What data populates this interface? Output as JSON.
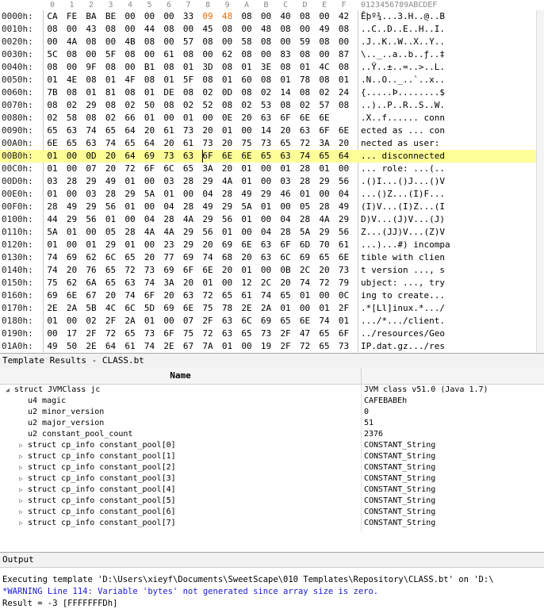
{
  "hex": {
    "ruler_cols": [
      "0",
      "1",
      "2",
      "3",
      "4",
      "5",
      "6",
      "7",
      "8",
      "9",
      "A",
      "B",
      "C",
      "D",
      "E",
      "F"
    ],
    "ruler_ascii": "0123456789ABCDEF",
    "rows": [
      {
        "addr": "0000h:",
        "bytes": [
          "CA",
          "FE",
          "BA",
          "BE",
          "00",
          "00",
          "00",
          "33",
          "09",
          "48",
          "08",
          "00",
          "40",
          "08",
          "00",
          "42"
        ],
        "ascii": "Êþº¾...3.H..@..B"
      },
      {
        "addr": "0010h:",
        "bytes": [
          "08",
          "00",
          "43",
          "08",
          "00",
          "44",
          "08",
          "00",
          "45",
          "08",
          "00",
          "48",
          "08",
          "00",
          "49",
          "08"
        ],
        "ascii": "..C..D..E..H..I."
      },
      {
        "addr": "0020h:",
        "bytes": [
          "00",
          "4A",
          "08",
          "00",
          "4B",
          "08",
          "00",
          "57",
          "08",
          "00",
          "58",
          "08",
          "00",
          "59",
          "08",
          "00"
        ],
        "ascii": ".J..K..W..X..Y.."
      },
      {
        "addr": "0030h:",
        "bytes": [
          "5C",
          "08",
          "00",
          "5F",
          "08",
          "00",
          "61",
          "08",
          "00",
          "62",
          "08",
          "00",
          "83",
          "08",
          "00",
          "87"
        ],
        "ascii": "\\.._..a..b..ƒ..‡"
      },
      {
        "addr": "0040h:",
        "bytes": [
          "08",
          "00",
          "9F",
          "08",
          "00",
          "B1",
          "08",
          "01",
          "3D",
          "08",
          "01",
          "3E",
          "08",
          "01",
          "4C",
          "08"
        ],
        "ascii": "..Ÿ..±..=..>..L."
      },
      {
        "addr": "0050h:",
        "bytes": [
          "01",
          "4E",
          "08",
          "01",
          "4F",
          "08",
          "01",
          "5F",
          "08",
          "01",
          "60",
          "08",
          "01",
          "78",
          "08",
          "01"
        ],
        "ascii": ".N..O.._..`..x.."
      },
      {
        "addr": "0060h:",
        "bytes": [
          "7B",
          "08",
          "01",
          "81",
          "08",
          "01",
          "DE",
          "08",
          "02",
          "0D",
          "08",
          "02",
          "14",
          "08",
          "02",
          "24"
        ],
        "ascii": "{.....Þ........$"
      },
      {
        "addr": "0070h:",
        "bytes": [
          "08",
          "02",
          "29",
          "08",
          "02",
          "50",
          "08",
          "02",
          "52",
          "08",
          "02",
          "53",
          "08",
          "02",
          "57",
          "08"
        ],
        "ascii": "..)..P..R..S..W."
      },
      {
        "addr": "0080h:",
        "bytes": [
          "02",
          "58",
          "08",
          "02",
          "66",
          "01",
          "00",
          "01",
          "00",
          "0E",
          "20",
          "63",
          "6F",
          "6E",
          "6E"
        ],
        "ascii": ".X..f...... conn"
      },
      {
        "addr": "0090h:",
        "bytes": [
          "65",
          "63",
          "74",
          "65",
          "64",
          "20",
          "61",
          "73",
          "20",
          "01",
          "00",
          "14",
          "20",
          "63",
          "6F",
          "6E"
        ],
        "ascii": "ected as ... con"
      },
      {
        "addr": "00A0h:",
        "bytes": [
          "6E",
          "65",
          "63",
          "74",
          "65",
          "64",
          "20",
          "61",
          "73",
          "20",
          "75",
          "73",
          "65",
          "72",
          "3A",
          "20"
        ],
        "ascii": "nected as user: "
      },
      {
        "addr": "00B0h:",
        "bytes": [
          "01",
          "00",
          "0D",
          "20",
          "64",
          "69",
          "73",
          "63",
          "6F",
          "6E",
          "6E",
          "65",
          "63",
          "74",
          "65",
          "64"
        ],
        "ascii": "... disconnected"
      },
      {
        "addr": "00C0h:",
        "bytes": [
          "01",
          "00",
          "07",
          "20",
          "72",
          "6F",
          "6C",
          "65",
          "3A",
          "20",
          "01",
          "00",
          "01",
          "28",
          "01",
          "00"
        ],
        "ascii": "... role: ...(.."
      },
      {
        "addr": "00D0h:",
        "bytes": [
          "03",
          "28",
          "29",
          "49",
          "01",
          "00",
          "03",
          "28",
          "29",
          "4A",
          "01",
          "00",
          "03",
          "28",
          "29",
          "56"
        ],
        "ascii": ".()I...()J...()V"
      },
      {
        "addr": "00E0h:",
        "bytes": [
          "01",
          "00",
          "03",
          "28",
          "29",
          "5A",
          "01",
          "00",
          "04",
          "28",
          "49",
          "29",
          "46",
          "01",
          "00",
          "04"
        ],
        "ascii": "...()Z...(I)F..."
      },
      {
        "addr": "00F0h:",
        "bytes": [
          "28",
          "49",
          "29",
          "56",
          "01",
          "00",
          "04",
          "28",
          "49",
          "29",
          "5A",
          "01",
          "00",
          "05",
          "28",
          "49"
        ],
        "ascii": "(I)V...(I)Z...(I"
      },
      {
        "addr": "0100h:",
        "bytes": [
          "44",
          "29",
          "56",
          "01",
          "00",
          "04",
          "28",
          "4A",
          "29",
          "56",
          "01",
          "00",
          "04",
          "28",
          "4A",
          "29"
        ],
        "ascii": "D)V...(J)V...(J)"
      },
      {
        "addr": "0110h:",
        "bytes": [
          "5A",
          "01",
          "00",
          "05",
          "28",
          "4A",
          "4A",
          "29",
          "56",
          "01",
          "00",
          "04",
          "28",
          "5A",
          "29",
          "56"
        ],
        "ascii": "Z...(JJ)V...(Z)V"
      },
      {
        "addr": "0120h:",
        "bytes": [
          "01",
          "00",
          "01",
          "29",
          "01",
          "00",
          "23",
          "29",
          "20",
          "69",
          "6E",
          "63",
          "6F",
          "6D",
          "70",
          "61"
        ],
        "ascii": "...)...#) incompa"
      },
      {
        "addr": "0130h:",
        "bytes": [
          "74",
          "69",
          "62",
          "6C",
          "65",
          "20",
          "77",
          "69",
          "74",
          "68",
          "20",
          "63",
          "6C",
          "69",
          "65",
          "6E"
        ],
        "ascii": "tible with clien"
      },
      {
        "addr": "0140h:",
        "bytes": [
          "74",
          "20",
          "76",
          "65",
          "72",
          "73",
          "69",
          "6F",
          "6E",
          "20",
          "01",
          "00",
          "0B",
          "2C",
          "20",
          "73"
        ],
        "ascii": "t version ..., s"
      },
      {
        "addr": "0150h:",
        "bytes": [
          "75",
          "62",
          "6A",
          "65",
          "63",
          "74",
          "3A",
          "20",
          "01",
          "00",
          "12",
          "2C",
          "20",
          "74",
          "72",
          "79"
        ],
        "ascii": "ubject: ..., try"
      },
      {
        "addr": "0160h:",
        "bytes": [
          "69",
          "6E",
          "67",
          "20",
          "74",
          "6F",
          "20",
          "63",
          "72",
          "65",
          "61",
          "74",
          "65",
          "01",
          "00",
          "0C"
        ],
        "ascii": "ing to create..."
      },
      {
        "addr": "0170h:",
        "bytes": [
          "2E",
          "2A",
          "5B",
          "4C",
          "6C",
          "5D",
          "69",
          "6E",
          "75",
          "78",
          "2E",
          "2A",
          "01",
          "00",
          "01",
          "2F"
        ],
        "ascii": ".*[Ll]inux.*.../"
      },
      {
        "addr": "0180h:",
        "bytes": [
          "01",
          "00",
          "02",
          "2F",
          "2A",
          "01",
          "00",
          "07",
          "2F",
          "63",
          "6C",
          "69",
          "65",
          "6E",
          "74",
          "01"
        ],
        "ascii": ".../*.../client."
      },
      {
        "addr": "0190h:",
        "bytes": [
          "00",
          "17",
          "2F",
          "72",
          "65",
          "73",
          "6F",
          "75",
          "72",
          "63",
          "65",
          "73",
          "2F",
          "47",
          "65",
          "6F"
        ],
        "ascii": "../resources/Geo"
      },
      {
        "addr": "01A0h:",
        "bytes": [
          "49",
          "50",
          "2E",
          "64",
          "61",
          "74",
          "2E",
          "67",
          "7A",
          "01",
          "00",
          "19",
          "2F",
          "72",
          "65",
          "73"
        ],
        "ascii": "IP.dat.gz.../res"
      }
    ]
  },
  "template": {
    "panel_title": "Template Results - CLASS.bt",
    "column_name": "Name",
    "rows": [
      {
        "name": "struct JVMClass jc",
        "value": "JVM class v51.0 (Java 1.7)",
        "level": 0,
        "toggle": "open"
      },
      {
        "name": "u4 magic",
        "value": "CAFEBABEh",
        "level": 1,
        "toggle": "none"
      },
      {
        "name": "u2 minor_version",
        "value": "0",
        "level": 1,
        "toggle": "none"
      },
      {
        "name": "u2 major_version",
        "value": "51",
        "level": 1,
        "toggle": "none"
      },
      {
        "name": "u2 constant_pool_count",
        "value": "2376",
        "level": 1,
        "toggle": "none"
      },
      {
        "name": "struct cp_info constant_pool[0]",
        "value": "CONSTANT_String",
        "level": 1,
        "toggle": "closed"
      },
      {
        "name": "struct cp_info constant_pool[1]",
        "value": "CONSTANT_String",
        "level": 1,
        "toggle": "closed"
      },
      {
        "name": "struct cp_info constant_pool[2]",
        "value": "CONSTANT_String",
        "level": 1,
        "toggle": "closed"
      },
      {
        "name": "struct cp_info constant_pool[3]",
        "value": "CONSTANT_String",
        "level": 1,
        "toggle": "closed"
      },
      {
        "name": "struct cp_info constant_pool[4]",
        "value": "CONSTANT_String",
        "level": 1,
        "toggle": "closed"
      },
      {
        "name": "struct cp_info constant_pool[5]",
        "value": "CONSTANT_String",
        "level": 1,
        "toggle": "closed"
      },
      {
        "name": "struct cp_info constant_pool[6]",
        "value": "CONSTANT_String",
        "level": 1,
        "toggle": "closed"
      },
      {
        "name": "struct cp_info constant_pool[7]",
        "value": "CONSTANT_String",
        "level": 1,
        "toggle": "closed"
      }
    ]
  },
  "output": {
    "panel_title": "Output",
    "lines": [
      {
        "text": "Executing template 'D:\\Users\\xieyf\\Documents\\SweetScape\\010 Templates\\Repository\\CLASS.bt' on 'D:\\",
        "color": "#000000"
      },
      {
        "text": "*WARNING Line 114: Variable 'bytes' not generated since array size is zero.",
        "color": "#1a1ad0"
      },
      {
        "text": "Result = -3 [FFFFFFFDh]",
        "color": "#000000"
      }
    ]
  },
  "colors": {
    "highlight_row": "#ffff99",
    "highlight_bytes": "#e86a00",
    "warning_text": "#1a1ad0"
  }
}
